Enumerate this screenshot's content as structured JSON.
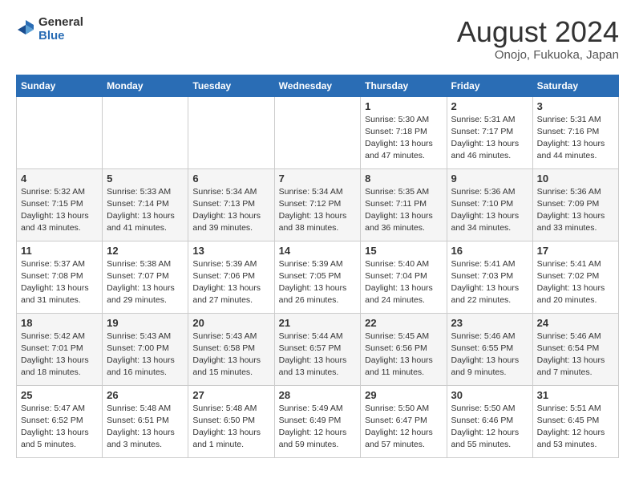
{
  "header": {
    "logo_general": "General",
    "logo_blue": "Blue",
    "month_year": "August 2024",
    "location": "Onojo, Fukuoka, Japan"
  },
  "weekdays": [
    "Sunday",
    "Monday",
    "Tuesday",
    "Wednesday",
    "Thursday",
    "Friday",
    "Saturday"
  ],
  "weeks": [
    [
      {
        "day": "",
        "info": ""
      },
      {
        "day": "",
        "info": ""
      },
      {
        "day": "",
        "info": ""
      },
      {
        "day": "",
        "info": ""
      },
      {
        "day": "1",
        "info": "Sunrise: 5:30 AM\nSunset: 7:18 PM\nDaylight: 13 hours\nand 47 minutes."
      },
      {
        "day": "2",
        "info": "Sunrise: 5:31 AM\nSunset: 7:17 PM\nDaylight: 13 hours\nand 46 minutes."
      },
      {
        "day": "3",
        "info": "Sunrise: 5:31 AM\nSunset: 7:16 PM\nDaylight: 13 hours\nand 44 minutes."
      }
    ],
    [
      {
        "day": "4",
        "info": "Sunrise: 5:32 AM\nSunset: 7:15 PM\nDaylight: 13 hours\nand 43 minutes."
      },
      {
        "day": "5",
        "info": "Sunrise: 5:33 AM\nSunset: 7:14 PM\nDaylight: 13 hours\nand 41 minutes."
      },
      {
        "day": "6",
        "info": "Sunrise: 5:34 AM\nSunset: 7:13 PM\nDaylight: 13 hours\nand 39 minutes."
      },
      {
        "day": "7",
        "info": "Sunrise: 5:34 AM\nSunset: 7:12 PM\nDaylight: 13 hours\nand 38 minutes."
      },
      {
        "day": "8",
        "info": "Sunrise: 5:35 AM\nSunset: 7:11 PM\nDaylight: 13 hours\nand 36 minutes."
      },
      {
        "day": "9",
        "info": "Sunrise: 5:36 AM\nSunset: 7:10 PM\nDaylight: 13 hours\nand 34 minutes."
      },
      {
        "day": "10",
        "info": "Sunrise: 5:36 AM\nSunset: 7:09 PM\nDaylight: 13 hours\nand 33 minutes."
      }
    ],
    [
      {
        "day": "11",
        "info": "Sunrise: 5:37 AM\nSunset: 7:08 PM\nDaylight: 13 hours\nand 31 minutes."
      },
      {
        "day": "12",
        "info": "Sunrise: 5:38 AM\nSunset: 7:07 PM\nDaylight: 13 hours\nand 29 minutes."
      },
      {
        "day": "13",
        "info": "Sunrise: 5:39 AM\nSunset: 7:06 PM\nDaylight: 13 hours\nand 27 minutes."
      },
      {
        "day": "14",
        "info": "Sunrise: 5:39 AM\nSunset: 7:05 PM\nDaylight: 13 hours\nand 26 minutes."
      },
      {
        "day": "15",
        "info": "Sunrise: 5:40 AM\nSunset: 7:04 PM\nDaylight: 13 hours\nand 24 minutes."
      },
      {
        "day": "16",
        "info": "Sunrise: 5:41 AM\nSunset: 7:03 PM\nDaylight: 13 hours\nand 22 minutes."
      },
      {
        "day": "17",
        "info": "Sunrise: 5:41 AM\nSunset: 7:02 PM\nDaylight: 13 hours\nand 20 minutes."
      }
    ],
    [
      {
        "day": "18",
        "info": "Sunrise: 5:42 AM\nSunset: 7:01 PM\nDaylight: 13 hours\nand 18 minutes."
      },
      {
        "day": "19",
        "info": "Sunrise: 5:43 AM\nSunset: 7:00 PM\nDaylight: 13 hours\nand 16 minutes."
      },
      {
        "day": "20",
        "info": "Sunrise: 5:43 AM\nSunset: 6:58 PM\nDaylight: 13 hours\nand 15 minutes."
      },
      {
        "day": "21",
        "info": "Sunrise: 5:44 AM\nSunset: 6:57 PM\nDaylight: 13 hours\nand 13 minutes."
      },
      {
        "day": "22",
        "info": "Sunrise: 5:45 AM\nSunset: 6:56 PM\nDaylight: 13 hours\nand 11 minutes."
      },
      {
        "day": "23",
        "info": "Sunrise: 5:46 AM\nSunset: 6:55 PM\nDaylight: 13 hours\nand 9 minutes."
      },
      {
        "day": "24",
        "info": "Sunrise: 5:46 AM\nSunset: 6:54 PM\nDaylight: 13 hours\nand 7 minutes."
      }
    ],
    [
      {
        "day": "25",
        "info": "Sunrise: 5:47 AM\nSunset: 6:52 PM\nDaylight: 13 hours\nand 5 minutes."
      },
      {
        "day": "26",
        "info": "Sunrise: 5:48 AM\nSunset: 6:51 PM\nDaylight: 13 hours\nand 3 minutes."
      },
      {
        "day": "27",
        "info": "Sunrise: 5:48 AM\nSunset: 6:50 PM\nDaylight: 13 hours\nand 1 minute."
      },
      {
        "day": "28",
        "info": "Sunrise: 5:49 AM\nSunset: 6:49 PM\nDaylight: 12 hours\nand 59 minutes."
      },
      {
        "day": "29",
        "info": "Sunrise: 5:50 AM\nSunset: 6:47 PM\nDaylight: 12 hours\nand 57 minutes."
      },
      {
        "day": "30",
        "info": "Sunrise: 5:50 AM\nSunset: 6:46 PM\nDaylight: 12 hours\nand 55 minutes."
      },
      {
        "day": "31",
        "info": "Sunrise: 5:51 AM\nSunset: 6:45 PM\nDaylight: 12 hours\nand 53 minutes."
      }
    ]
  ]
}
